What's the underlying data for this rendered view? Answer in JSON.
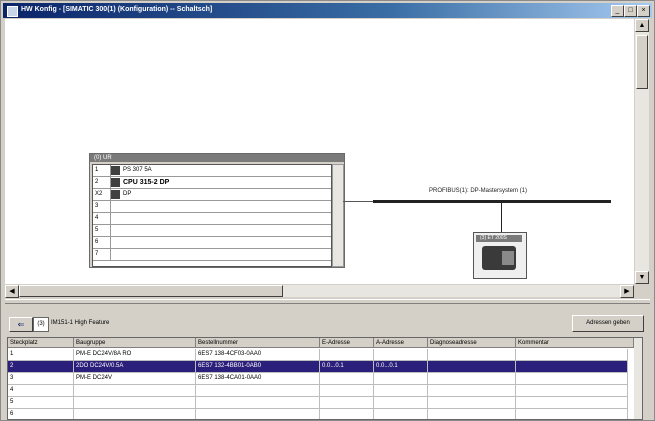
{
  "window": {
    "title": "HW Konfig - [SIMATIC 300(1) (Konfiguration) -- Schaltsch]"
  },
  "window_buttons": {
    "minimize": "_",
    "restore": "□",
    "close": "×"
  },
  "rack": {
    "title": "(0) UR",
    "rows": [
      {
        "slot": "1",
        "module": "PS 307 5A"
      },
      {
        "slot": "2",
        "module": "CPU 315-2 DP"
      },
      {
        "slot": "X2",
        "module": "DP"
      },
      {
        "slot": "3",
        "module": ""
      },
      {
        "slot": "4",
        "module": ""
      },
      {
        "slot": "5",
        "module": ""
      },
      {
        "slot": "6",
        "module": ""
      },
      {
        "slot": "7",
        "module": ""
      }
    ]
  },
  "network": {
    "label": "PROFIBUS(1): DP-Mastersystem (1)",
    "device_label": "(3) ET 200S"
  },
  "detail": {
    "slot": "(3)",
    "path": "IM151-1 High Feature",
    "address_button": "Adressen geben",
    "columns": [
      "Steckplatz",
      "Baugruppe",
      "Bestellnummer",
      "E-Adresse",
      "A-Adresse",
      "Diagnoseadresse",
      "Kommentar"
    ],
    "rows": [
      {
        "slot": "1",
        "module": "PM-E DC24V/8A RO",
        "order": "6ES7 138-4CF03-0AA0",
        "e": "",
        "a": "",
        "diag": "",
        "comment": ""
      },
      {
        "slot": "2",
        "module": "2DO DC24V/0.5A",
        "order": "6ES7 132-4BB01-0AB0",
        "e": "0.0...0.1",
        "a": "0.0...0.1",
        "diag": "",
        "comment": ""
      },
      {
        "slot": "3",
        "module": "PM-E DC24V",
        "order": "6ES7 138-4CA01-0AA0",
        "e": "",
        "a": "",
        "diag": "",
        "comment": ""
      },
      {
        "slot": "4",
        "module": "",
        "order": "",
        "e": "",
        "a": "",
        "diag": "",
        "comment": ""
      },
      {
        "slot": "5",
        "module": "",
        "order": "",
        "e": "",
        "a": "",
        "diag": "",
        "comment": ""
      },
      {
        "slot": "6",
        "module": "",
        "order": "",
        "e": "",
        "a": "",
        "diag": "",
        "comment": ""
      }
    ],
    "selected_row": 1
  }
}
